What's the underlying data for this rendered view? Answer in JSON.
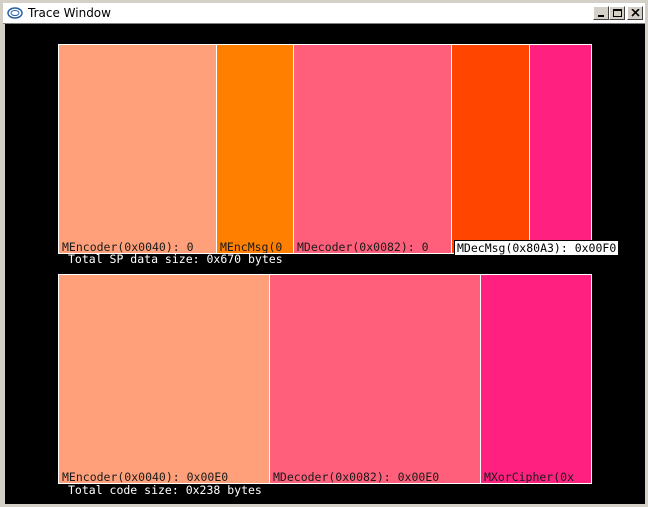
{
  "window": {
    "title": "Trace Window"
  },
  "sp_chart": {
    "caption": "Total SP data size: 0x670 bytes",
    "segments": [
      {
        "label": "MEncoder(0x0040): 0",
        "color": "#ffa07a"
      },
      {
        "label": "MEncMsg(0",
        "color": "#ff8000"
      },
      {
        "label": "MDecoder(0x0082): 0",
        "color": "#ff5f7a"
      },
      {
        "label": "",
        "color": "#ff4500"
      },
      {
        "label": "",
        "color": "#ff2080"
      }
    ],
    "tooltip": "MDecMsg(0x80A3): 0x00F0"
  },
  "code_chart": {
    "caption": "Total code size: 0x238 bytes",
    "segments": [
      {
        "label": "MEncoder(0x0040): 0x00E0",
        "color": "#ffa07a"
      },
      {
        "label": "MDecoder(0x0082): 0x00E0",
        "color": "#ff5f7a"
      },
      {
        "label": "MXorCipher(0x",
        "color": "#ff2080"
      }
    ]
  }
}
